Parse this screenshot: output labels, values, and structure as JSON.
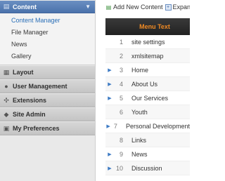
{
  "sidebar": {
    "content": {
      "title": "Content",
      "items": [
        "Content Manager",
        "File Manager",
        "News",
        "Gallery"
      ]
    },
    "sections": [
      {
        "title": "Layout"
      },
      {
        "title": "User Management"
      },
      {
        "title": "Extensions"
      },
      {
        "title": "Site Admin"
      },
      {
        "title": "My Preferences"
      }
    ]
  },
  "toolbar": {
    "add_label": "Add New Content",
    "expand_label": "Expand"
  },
  "grid": {
    "header": "Menu Text",
    "rows": [
      {
        "num": "1",
        "name": "site settings",
        "expandable": false
      },
      {
        "num": "2",
        "name": "xmlsitemap",
        "expandable": false
      },
      {
        "num": "3",
        "name": "Home",
        "expandable": true
      },
      {
        "num": "4",
        "name": "About Us",
        "expandable": true
      },
      {
        "num": "5",
        "name": "Our Services",
        "expandable": true
      },
      {
        "num": "6",
        "name": "Youth",
        "expandable": false
      },
      {
        "num": "7",
        "name": "Personal Development",
        "expandable": true
      },
      {
        "num": "8",
        "name": "Links",
        "expandable": false
      },
      {
        "num": "9",
        "name": "News",
        "expandable": true
      },
      {
        "num": "10",
        "name": "Discussion",
        "expandable": true
      }
    ]
  },
  "colors": {
    "accent": "#4a72ab",
    "header_text": "#f08a24",
    "active_link": "#2a6fb8"
  }
}
